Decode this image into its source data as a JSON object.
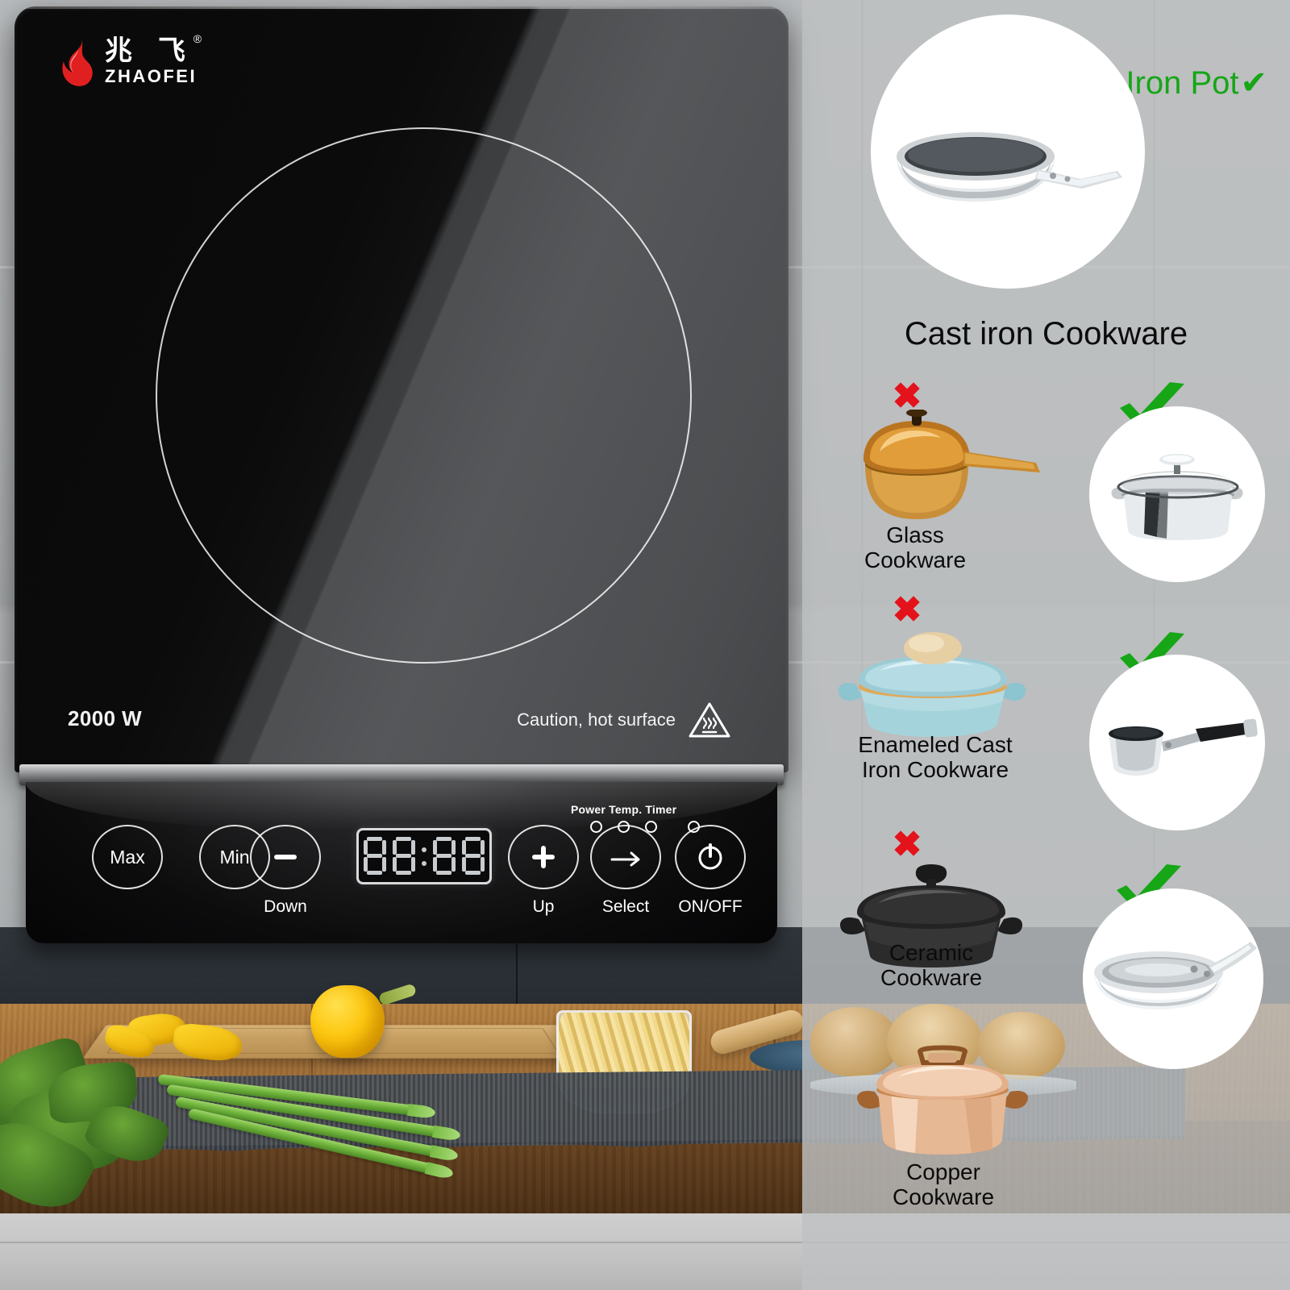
{
  "product": {
    "brand_cn": "兆 飞",
    "brand_en": "ZHAOFEI",
    "registered_mark": "®",
    "power_rating": "2000 W",
    "caution_text": "Caution, hot surface",
    "caution_icon": "hot-surface-triangle-icon"
  },
  "control_panel": {
    "buttons": [
      {
        "key": "Max",
        "label": "",
        "icon": "none"
      },
      {
        "key": "Min",
        "label": "",
        "icon": "none"
      },
      {
        "key": "",
        "label": "Down",
        "icon": "minus-icon"
      },
      {
        "key": "",
        "label": "Up",
        "icon": "plus-icon"
      },
      {
        "key": "",
        "label": "Select",
        "icon": "arrow-right-icon"
      },
      {
        "key": "",
        "label": "ON/OFF",
        "icon": "power-icon"
      }
    ],
    "max_label": "Max",
    "min_label": "Min",
    "down_label": "Down",
    "up_label": "Up",
    "select_label": "Select",
    "onoff_label": "ON/OFF",
    "display": {
      "value": "88:88",
      "digits": [
        "8",
        "8",
        "8",
        "8"
      ],
      "separator": ":"
    },
    "indicators": {
      "group_label": "Power Temp. Timer",
      "items": [
        "Power",
        "Temp.",
        "Timer"
      ]
    }
  },
  "comparison": {
    "header": "Iron Pot",
    "header_check": "✔",
    "header_color": "#16a616",
    "featured": {
      "label": "Cast iron Cookware",
      "item": "nonstick-frying-pan"
    },
    "incompatible_mark": "✖",
    "incompatible_color": "#e4121a",
    "compatible_color": "#16a616",
    "incompatible": [
      {
        "label": "Glass\nCookware",
        "item": "amber-glass-saucepan"
      },
      {
        "label": "Enameled Cast\nIron Cookware",
        "item": "blue-enamel-casserole"
      },
      {
        "label": "Ceramic\nCookware",
        "item": "black-ceramic-pot"
      },
      {
        "label": "Copper\nCookware",
        "item": "copper-stockpot"
      }
    ],
    "compatible": [
      {
        "item": "stainless-steel-pot-with-lid"
      },
      {
        "item": "stainless-steel-saucepan"
      },
      {
        "item": "stainless-steel-frying-pan"
      }
    ]
  },
  "scene": {
    "items": [
      "cutting-board",
      "yellow-bell-pepper",
      "pepper-slices",
      "asparagus",
      "parsley",
      "pasta-bowl",
      "rolling-pin",
      "placemat",
      "wood-countertop"
    ]
  }
}
